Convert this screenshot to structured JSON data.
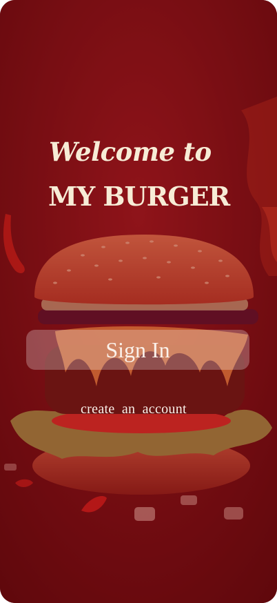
{
  "screen": {
    "welcome_text": "Welcome to",
    "brand_text": "MY BURGER",
    "signin_label": "Sign In",
    "create_account_label": "create  an  account"
  },
  "colors": {
    "background": "#6e0f14",
    "tint": "#960c14",
    "text": "#f7ecd6",
    "button_fill": "rgba(255,255,255,0.26)"
  },
  "images": {
    "background": "burger-photo"
  }
}
